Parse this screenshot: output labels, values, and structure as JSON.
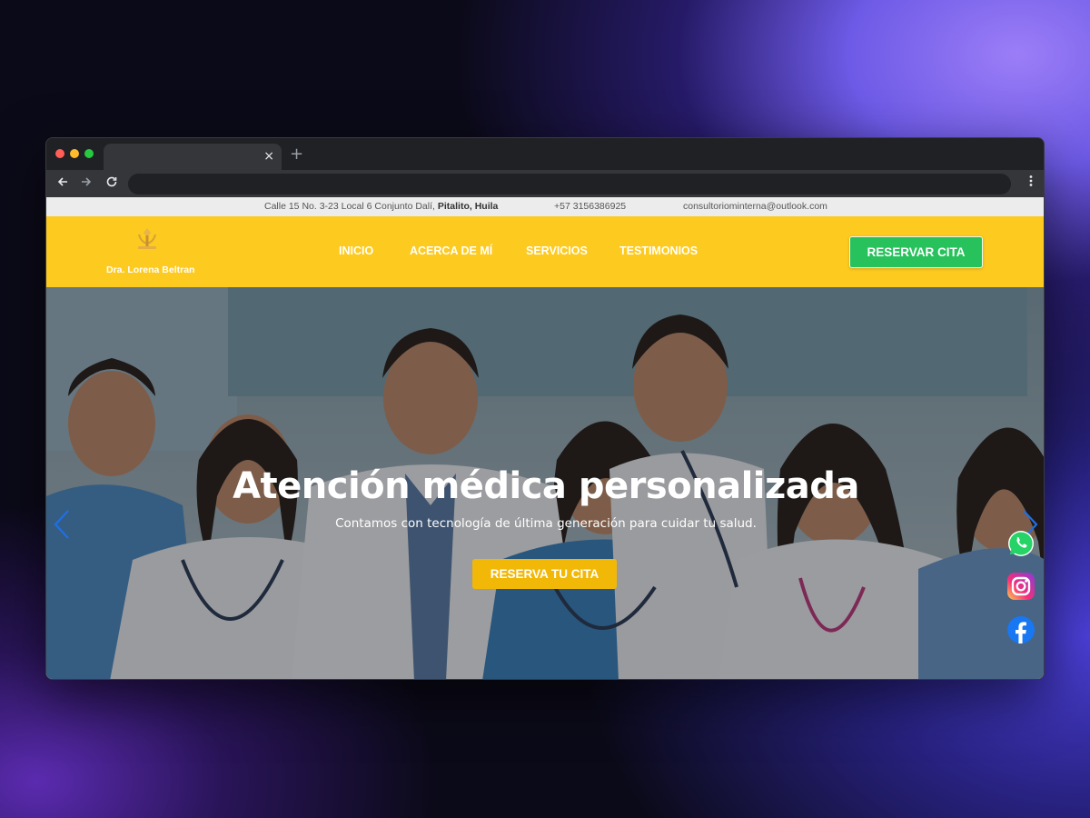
{
  "browser": {
    "tab_close_glyph": "×",
    "new_tab_glyph": "+",
    "url": ""
  },
  "topbar": {
    "address": "Calle 15 No. 3-23 Local 6 Conjunto Dalí,",
    "address_city": "Pitalito, Huila",
    "phone": "+57 3156386925",
    "email": "consultoriominterna@outlook.com"
  },
  "header": {
    "logo_name": "Dra. Lorena Beltran",
    "nav": [
      "INICIO",
      "ACERCA DE MÍ",
      "SERVICIOS",
      "TESTIMONIOS"
    ],
    "cta": "RESERVAR CITA"
  },
  "hero": {
    "title": "Atención médica personalizada",
    "subtitle": "Contamos con tecnología de última generación para cuidar tu salud.",
    "cta": "RESERVA TU CITA"
  },
  "social": [
    "whatsapp-icon",
    "instagram-icon",
    "facebook-icon"
  ],
  "colors": {
    "header": "#fdca1f",
    "reservar_button": "#27c25c",
    "hero_button": "#f2b807",
    "arrows": "#1e6fe8"
  }
}
